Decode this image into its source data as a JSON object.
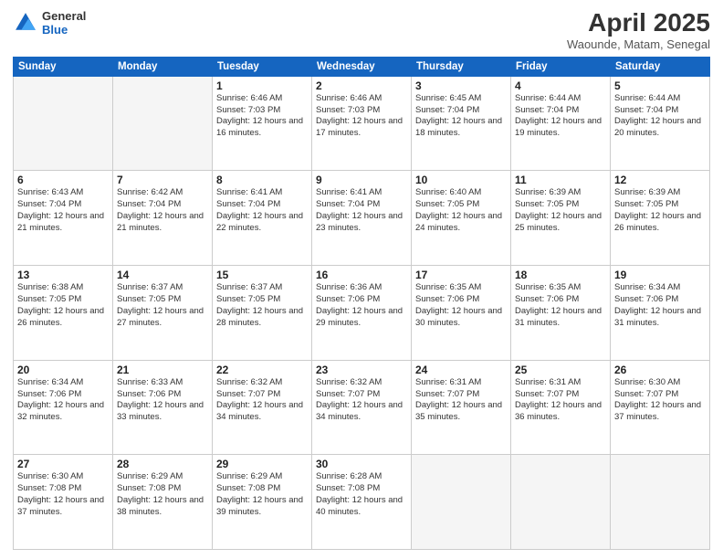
{
  "logo": {
    "line1": "General",
    "line2": "Blue"
  },
  "title": "April 2025",
  "subtitle": "Waounde, Matam, Senegal",
  "days_of_week": [
    "Sunday",
    "Monday",
    "Tuesday",
    "Wednesday",
    "Thursday",
    "Friday",
    "Saturday"
  ],
  "weeks": [
    [
      {
        "day": "",
        "info": ""
      },
      {
        "day": "",
        "info": ""
      },
      {
        "day": "1",
        "info": "Sunrise: 6:46 AM\nSunset: 7:03 PM\nDaylight: 12 hours and 16 minutes."
      },
      {
        "day": "2",
        "info": "Sunrise: 6:46 AM\nSunset: 7:03 PM\nDaylight: 12 hours and 17 minutes."
      },
      {
        "day": "3",
        "info": "Sunrise: 6:45 AM\nSunset: 7:04 PM\nDaylight: 12 hours and 18 minutes."
      },
      {
        "day": "4",
        "info": "Sunrise: 6:44 AM\nSunset: 7:04 PM\nDaylight: 12 hours and 19 minutes."
      },
      {
        "day": "5",
        "info": "Sunrise: 6:44 AM\nSunset: 7:04 PM\nDaylight: 12 hours and 20 minutes."
      }
    ],
    [
      {
        "day": "6",
        "info": "Sunrise: 6:43 AM\nSunset: 7:04 PM\nDaylight: 12 hours and 21 minutes."
      },
      {
        "day": "7",
        "info": "Sunrise: 6:42 AM\nSunset: 7:04 PM\nDaylight: 12 hours and 21 minutes."
      },
      {
        "day": "8",
        "info": "Sunrise: 6:41 AM\nSunset: 7:04 PM\nDaylight: 12 hours and 22 minutes."
      },
      {
        "day": "9",
        "info": "Sunrise: 6:41 AM\nSunset: 7:04 PM\nDaylight: 12 hours and 23 minutes."
      },
      {
        "day": "10",
        "info": "Sunrise: 6:40 AM\nSunset: 7:05 PM\nDaylight: 12 hours and 24 minutes."
      },
      {
        "day": "11",
        "info": "Sunrise: 6:39 AM\nSunset: 7:05 PM\nDaylight: 12 hours and 25 minutes."
      },
      {
        "day": "12",
        "info": "Sunrise: 6:39 AM\nSunset: 7:05 PM\nDaylight: 12 hours and 26 minutes."
      }
    ],
    [
      {
        "day": "13",
        "info": "Sunrise: 6:38 AM\nSunset: 7:05 PM\nDaylight: 12 hours and 26 minutes."
      },
      {
        "day": "14",
        "info": "Sunrise: 6:37 AM\nSunset: 7:05 PM\nDaylight: 12 hours and 27 minutes."
      },
      {
        "day": "15",
        "info": "Sunrise: 6:37 AM\nSunset: 7:05 PM\nDaylight: 12 hours and 28 minutes."
      },
      {
        "day": "16",
        "info": "Sunrise: 6:36 AM\nSunset: 7:06 PM\nDaylight: 12 hours and 29 minutes."
      },
      {
        "day": "17",
        "info": "Sunrise: 6:35 AM\nSunset: 7:06 PM\nDaylight: 12 hours and 30 minutes."
      },
      {
        "day": "18",
        "info": "Sunrise: 6:35 AM\nSunset: 7:06 PM\nDaylight: 12 hours and 31 minutes."
      },
      {
        "day": "19",
        "info": "Sunrise: 6:34 AM\nSunset: 7:06 PM\nDaylight: 12 hours and 31 minutes."
      }
    ],
    [
      {
        "day": "20",
        "info": "Sunrise: 6:34 AM\nSunset: 7:06 PM\nDaylight: 12 hours and 32 minutes."
      },
      {
        "day": "21",
        "info": "Sunrise: 6:33 AM\nSunset: 7:06 PM\nDaylight: 12 hours and 33 minutes."
      },
      {
        "day": "22",
        "info": "Sunrise: 6:32 AM\nSunset: 7:07 PM\nDaylight: 12 hours and 34 minutes."
      },
      {
        "day": "23",
        "info": "Sunrise: 6:32 AM\nSunset: 7:07 PM\nDaylight: 12 hours and 34 minutes."
      },
      {
        "day": "24",
        "info": "Sunrise: 6:31 AM\nSunset: 7:07 PM\nDaylight: 12 hours and 35 minutes."
      },
      {
        "day": "25",
        "info": "Sunrise: 6:31 AM\nSunset: 7:07 PM\nDaylight: 12 hours and 36 minutes."
      },
      {
        "day": "26",
        "info": "Sunrise: 6:30 AM\nSunset: 7:07 PM\nDaylight: 12 hours and 37 minutes."
      }
    ],
    [
      {
        "day": "27",
        "info": "Sunrise: 6:30 AM\nSunset: 7:08 PM\nDaylight: 12 hours and 37 minutes."
      },
      {
        "day": "28",
        "info": "Sunrise: 6:29 AM\nSunset: 7:08 PM\nDaylight: 12 hours and 38 minutes."
      },
      {
        "day": "29",
        "info": "Sunrise: 6:29 AM\nSunset: 7:08 PM\nDaylight: 12 hours and 39 minutes."
      },
      {
        "day": "30",
        "info": "Sunrise: 6:28 AM\nSunset: 7:08 PM\nDaylight: 12 hours and 40 minutes."
      },
      {
        "day": "",
        "info": ""
      },
      {
        "day": "",
        "info": ""
      },
      {
        "day": "",
        "info": ""
      }
    ]
  ]
}
